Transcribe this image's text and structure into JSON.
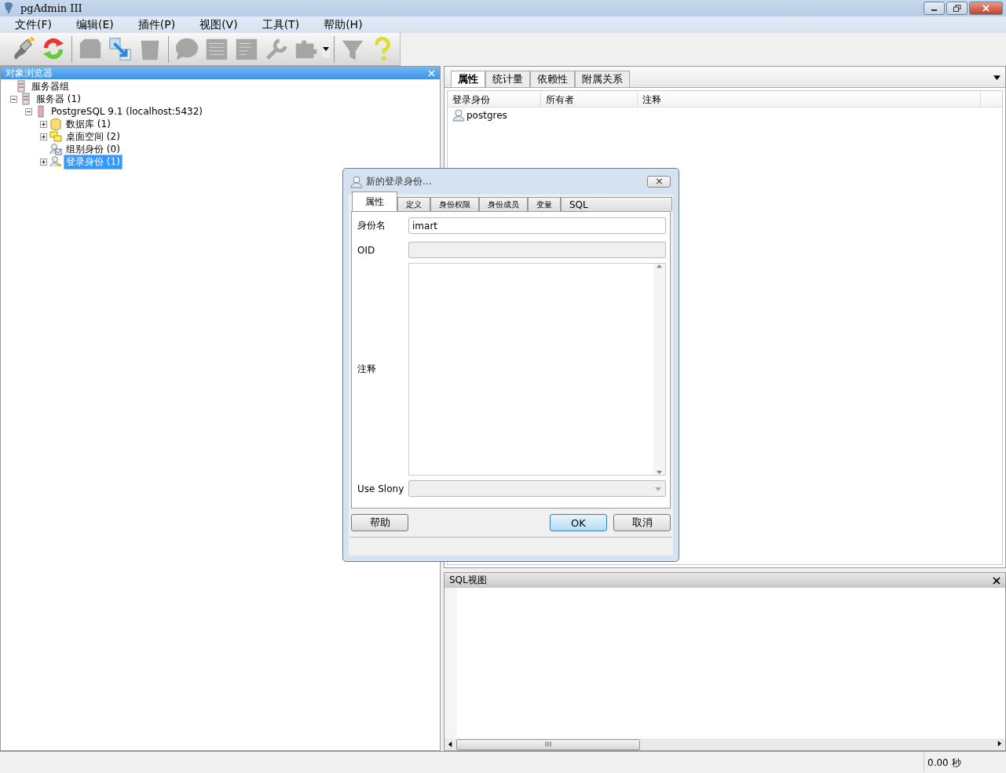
{
  "window": {
    "title": "pgAdmin III"
  },
  "menu": [
    "文件(F)",
    "编辑(E)",
    "插件(P)",
    "视图(V)",
    "工具(T)",
    "帮助(H)"
  ],
  "toolbar": [
    {
      "kind": "plug",
      "disabled": false
    },
    {
      "kind": "refresh",
      "disabled": false
    },
    {
      "kind": "separator"
    },
    {
      "kind": "block",
      "disabled": true
    },
    {
      "kind": "transfer",
      "disabled": false
    },
    {
      "kind": "bin",
      "disabled": true
    },
    {
      "kind": "separator"
    },
    {
      "kind": "speech",
      "disabled": true
    },
    {
      "kind": "grid",
      "disabled": true
    },
    {
      "kind": "grid-edit",
      "disabled": true
    },
    {
      "kind": "wrench",
      "disabled": true
    },
    {
      "kind": "puzzle",
      "disabled": true
    },
    {
      "kind": "dropdown"
    },
    {
      "kind": "separator"
    },
    {
      "kind": "funnel",
      "disabled": true
    },
    {
      "kind": "help",
      "disabled": false
    }
  ],
  "object_browser": {
    "title": "对象浏览器",
    "tree": [
      {
        "label": "服务器组",
        "kind": "server-group",
        "selected": false,
        "children": [
          {
            "label": "服务器 (1)",
            "kind": "server",
            "expanded": true,
            "selected": false,
            "children": [
              {
                "label": "PostgreSQL 9.1 (localhost:5432)",
                "kind": "database-server",
                "expanded": true,
                "selected": false,
                "children": [
                  {
                    "label": "数据库  (1)",
                    "kind": "database",
                    "expanded": false,
                    "selected": false
                  },
                  {
                    "label": "桌面空间 (2)",
                    "kind": "tablespace",
                    "expanded": false,
                    "selected": false
                  },
                  {
                    "label": "组别身份 (0)",
                    "kind": "group-role",
                    "selected": false
                  },
                  {
                    "label": "登录身份 (1)",
                    "kind": "login-role",
                    "expanded": false,
                    "selected": true
                  }
                ]
              }
            ]
          }
        ]
      }
    ]
  },
  "properties": {
    "tabs": [
      {
        "label": "属性",
        "selected": true
      },
      {
        "label": "统计量",
        "selected": false
      },
      {
        "label": "依赖性",
        "selected": false
      },
      {
        "label": "附属关系",
        "selected": false
      }
    ],
    "columns": [
      "登录身份",
      "所有者",
      "注释"
    ],
    "rows": [
      {
        "login_role": "postgres"
      }
    ]
  },
  "sql_pane": {
    "title": "SQL视图"
  },
  "status_bar": {
    "time": "0.00 秒"
  },
  "dialog": {
    "title": "新的登录身份...",
    "tabs": [
      {
        "label": "属性",
        "selected": true
      },
      {
        "label": "定义",
        "selected": false
      },
      {
        "label": "身份权限",
        "selected": false
      },
      {
        "label": "身份成员",
        "selected": false
      },
      {
        "label": "变量",
        "selected": false
      },
      {
        "label": "SQL",
        "selected": false
      }
    ],
    "fields": [
      {
        "kind": "text",
        "label": "身份名",
        "value": "imart"
      },
      {
        "kind": "readonly",
        "label": "OID"
      },
      {
        "kind": "textarea",
        "label": "注释"
      },
      {
        "kind": "select",
        "label": "Use Slony"
      }
    ],
    "buttons": [
      {
        "label": "帮助",
        "kind": "help"
      },
      {
        "label": "OK",
        "kind": "default"
      },
      {
        "label": "取消",
        "kind": "normal"
      }
    ]
  }
}
